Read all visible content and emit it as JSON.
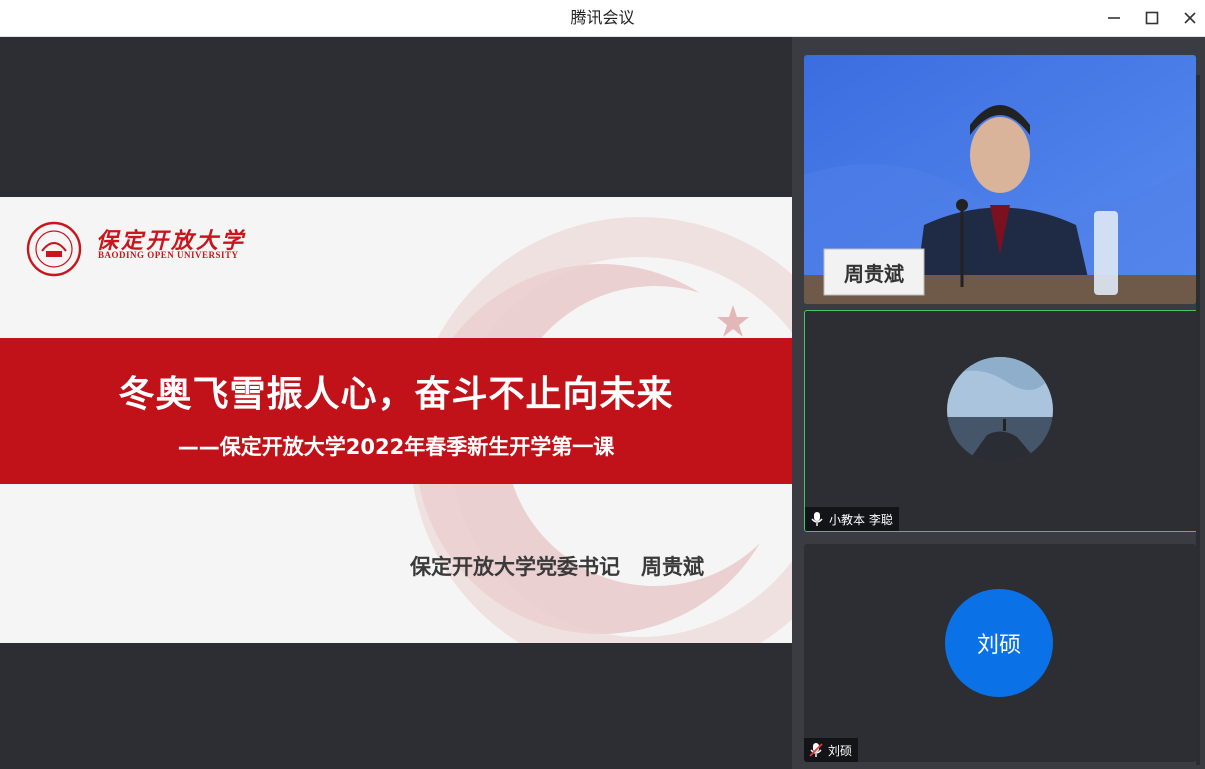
{
  "window": {
    "title": "腾讯会议"
  },
  "slide": {
    "logo_cn": "保定开放大学",
    "logo_en": "BAODING OPEN UNIVERSITY",
    "headline": "冬奥飞雪振人心，奋斗不止向未来",
    "subline": "——保定开放大学2022年春季新生开学第一课",
    "speaker": "保定开放大学党委书记　周贵斌"
  },
  "participants": [
    {
      "nameplate": "周贵斌",
      "video": "on"
    },
    {
      "name": "小教本 李聪",
      "mic": "on",
      "active": true
    },
    {
      "name": "刘硕",
      "initials": "刘硕",
      "mic": "muted"
    }
  ],
  "colors": {
    "slide_red": "#c1121a",
    "avatar_blue": "#0a72e6",
    "active_border": "#45c36b"
  }
}
